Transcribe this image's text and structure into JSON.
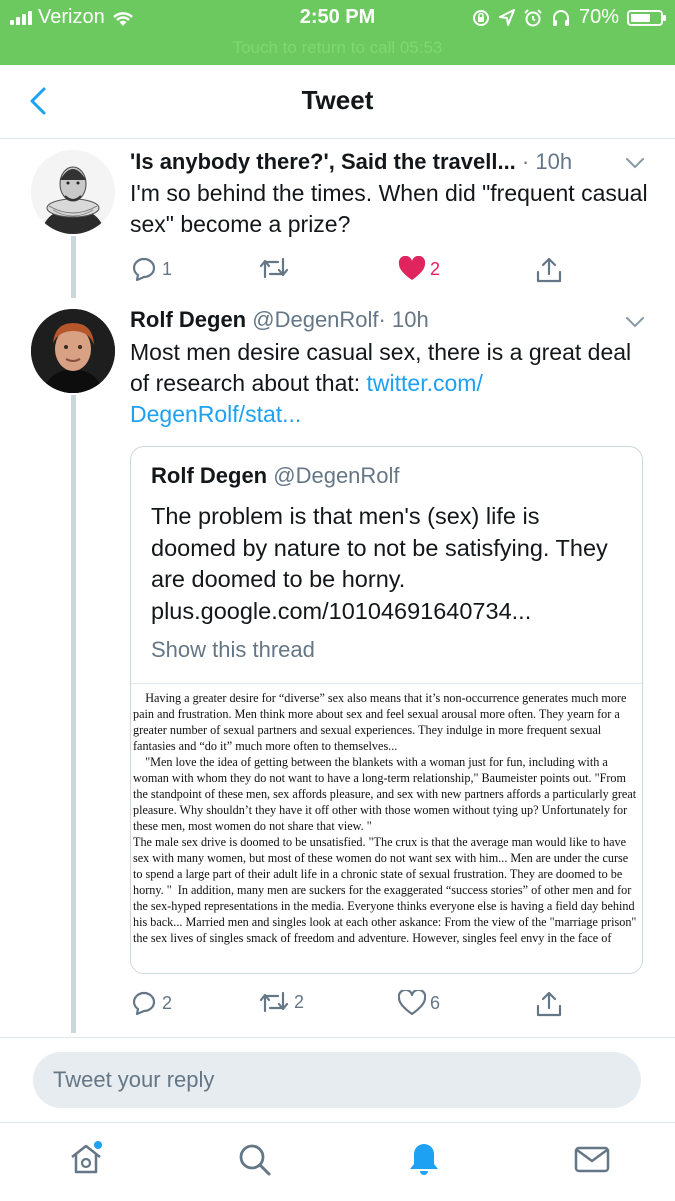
{
  "status_bar": {
    "carrier": "Verizon",
    "time": "2:50 PM",
    "battery": "70%",
    "call_banner": "Touch to return to call 05:53"
  },
  "nav": {
    "title": "Tweet"
  },
  "tweets": [
    {
      "name": "'Is anybody there?', Said the travell...",
      "time": "· 10h",
      "text": "I'm so behind the times. When did \"frequent casual sex\" become a prize?",
      "reply_count": "1",
      "retweet_count": "",
      "like_count": "2",
      "liked": true
    },
    {
      "name": "Rolf Degen",
      "handle": "@DegenRolf",
      "time": "· 10h",
      "text": "Most men desire casual sex, there is a great deal of research about that: ",
      "link": "twitter.com/ DegenRolf/stat...",
      "quoted": {
        "name": "Rolf Degen",
        "handle": "@DegenRolf",
        "text": "The problem is that men's (sex) life is doomed by nature to not be satisfying. They are doomed to be horny. plus.google.com/10104691640734...",
        "show_thread": "Show this thread",
        "image_text": "    Having a greater desire for “diverse” sex also means that it’s non-occurrence generates much more pain and frustration. Men think more about sex and feel sexual arousal more often. They yearn for a greater number of sexual partners and sexual experiences. They indulge in more frequent sexual fantasies and “do it” much more often to themselves...\n    \"Men love the idea of getting between the blankets with a woman just for fun, including with a woman with whom they do not want to have a long-term relationship,\" Baumeister points out. \"From the standpoint of these men, sex affords pleasure, and sex with new partners affords a particularly great pleasure. Why shouldn’t they have it off other with those women without tying up? Unfortunately for these men, most women do not share that view. \"\nThe male sex drive is doomed to be unsatisfied. \"The crux is that the average man would like to have sex with many women, but most of these women do not want sex with him... Men are under the curse to spend a large part of their adult life in a chronic state of sexual frustration. They are doomed to be horny. \"  In addition, many men are suckers for the exaggerated “success stories” of other men and for the sex-hyped representations in the media. Everyone thinks everyone else is having a field day behind his back... Married men and singles look at each other askance: From the view of the \"marriage prison\" the sex lives of singles smack of freedom and adventure. However, singles feel envy in the face of"
      },
      "reply_count": "2",
      "retweet_count": "2",
      "like_count": "6",
      "liked": false
    }
  ],
  "reply": {
    "placeholder": "Tweet your reply"
  },
  "tab_bar": [
    "home-icon",
    "search-icon",
    "notifications-icon",
    "messages-icon"
  ],
  "colors": {
    "accent": "#1da1f2",
    "like": "#e0245e",
    "status_bar": "#6cc95f",
    "muted": "#657786"
  }
}
